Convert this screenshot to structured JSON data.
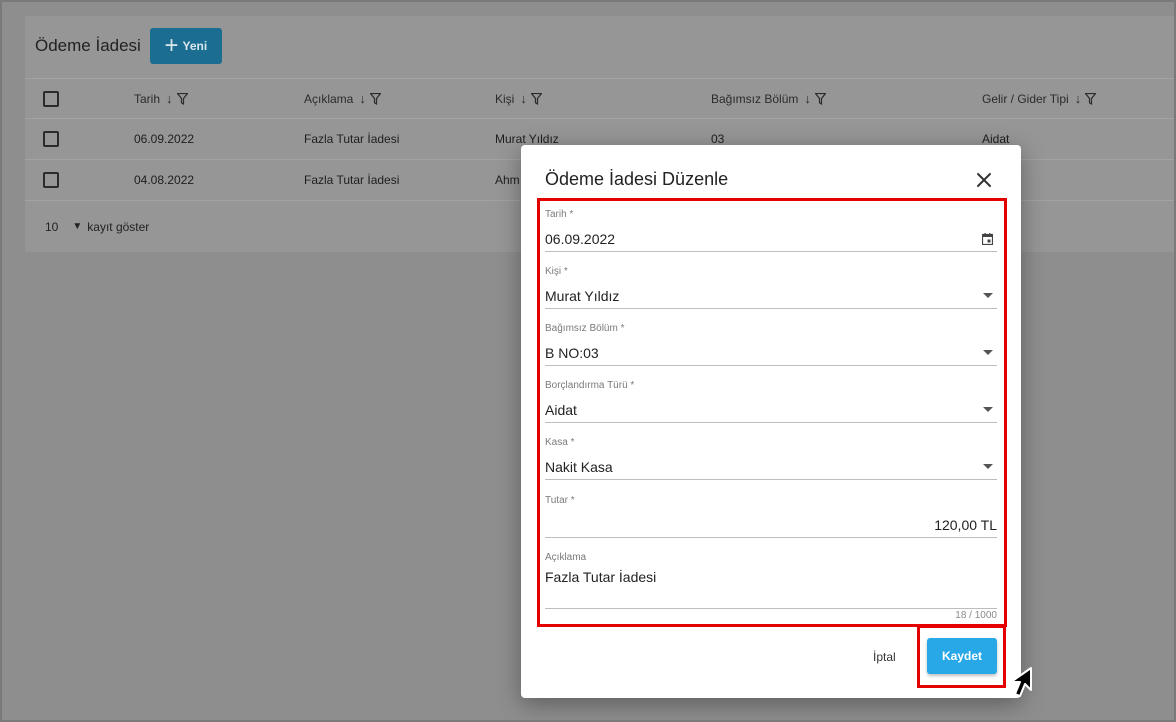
{
  "page": {
    "title": "Ödeme İadesi",
    "new_button_label": "Yeni"
  },
  "table": {
    "columns": [
      "Tarih",
      "Açıklama",
      "Kişi",
      "Bağımsız Bölüm",
      "Gelir / Gider Tipi"
    ],
    "rows": [
      {
        "date": "06.09.2022",
        "description": "Fazla Tutar İadesi",
        "person": "Murat Yıldız",
        "unit": "03",
        "type": "Aidat"
      },
      {
        "date": "04.08.2022",
        "description": "Fazla Tutar İadesi",
        "person": "Ahm"
      }
    ],
    "footer": {
      "page_size": "10",
      "label": "kayıt göster"
    }
  },
  "dialog": {
    "title": "Ödeme İadesi Düzenle",
    "fields": {
      "date": {
        "label": "Tarih *",
        "value": "06.09.2022"
      },
      "person": {
        "label": "Kişi *",
        "value": "Murat Yıldız"
      },
      "unit": {
        "label": "Bağımsız Bölüm *",
        "value": "B NO:03"
      },
      "debt_type": {
        "label": "Borçlandırma Türü *",
        "value": "Aidat"
      },
      "cash": {
        "label": "Kasa *",
        "value": "Nakit Kasa"
      },
      "amount": {
        "label": "Tutar *",
        "value": "120,00 TL"
      },
      "description": {
        "label": "Açıklama",
        "value": "Fazla Tutar İadesi",
        "counter": "18 / 1000"
      }
    },
    "cancel_label": "İptal",
    "save_label": "Kaydet"
  },
  "colors": {
    "highlight": "#e50000",
    "save_button": "#29a8e8",
    "new_button": "#1b6d92"
  }
}
